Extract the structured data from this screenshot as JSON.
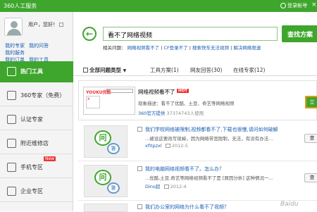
{
  "app": {
    "title": "360人工服务",
    "account": "登录帐号"
  },
  "user": {
    "greeting": "用户，您好！",
    "links": [
      "我的专家",
      "我的问答",
      "我的服务",
      "我的订单",
      "我的工具"
    ]
  },
  "sidebar": {
    "items": [
      {
        "label": "热门工具",
        "active": true
      },
      {
        "label": "360专家（免费）"
      },
      {
        "label": "认证专家"
      },
      {
        "label": "附近维修店"
      },
      {
        "label": "手机专区",
        "badge": "New"
      },
      {
        "label": "企业专区"
      }
    ]
  },
  "search": {
    "value": "看不了网络视频",
    "button": "查找方案",
    "related_label": "相关问题：",
    "related": [
      "网络视频看不了",
      "CF登录不了",
      "搜索快车无法视频",
      "解决网络限速"
    ]
  },
  "tabs": {
    "all": "全部问题类型",
    "tools": "工具方案(1)",
    "answers": "网友回答(30)",
    "experts": "在线专家(12)"
  },
  "featured": {
    "brand": "YOUKU优酷",
    "thumb_text": "x",
    "title": "网络视频看不了",
    "badge": "HOT",
    "desc": "现象描述：看不了优酷、土豆、奇艺等网络视频",
    "source": "360官方提供",
    "users": "37374743人使用",
    "action": "立"
  },
  "answers": [
    {
      "title": "我们学校网络被限制,视频都看不了,下载也很慢,请问如何破解",
      "body": "...被设这要改写现掉，因为网络带宽限制，无法，有没有办法...",
      "user": "xfitpzxl",
      "date": "2012-5",
      "action": "查"
    },
    {
      "title": "我的电脑网络视频看不了。怎么办？",
      "body": "...优酷,土豆,奇艺等网络视频看不了是 [原因分析] 这种情况一...",
      "user": "Dino超",
      "date": "2012-4",
      "action": "查"
    },
    {
      "title": "我们办公室的网络为什么看不了视频？",
      "body": "",
      "user": "",
      "date": "",
      "action": ""
    }
  ],
  "watermark": "Baidu"
}
